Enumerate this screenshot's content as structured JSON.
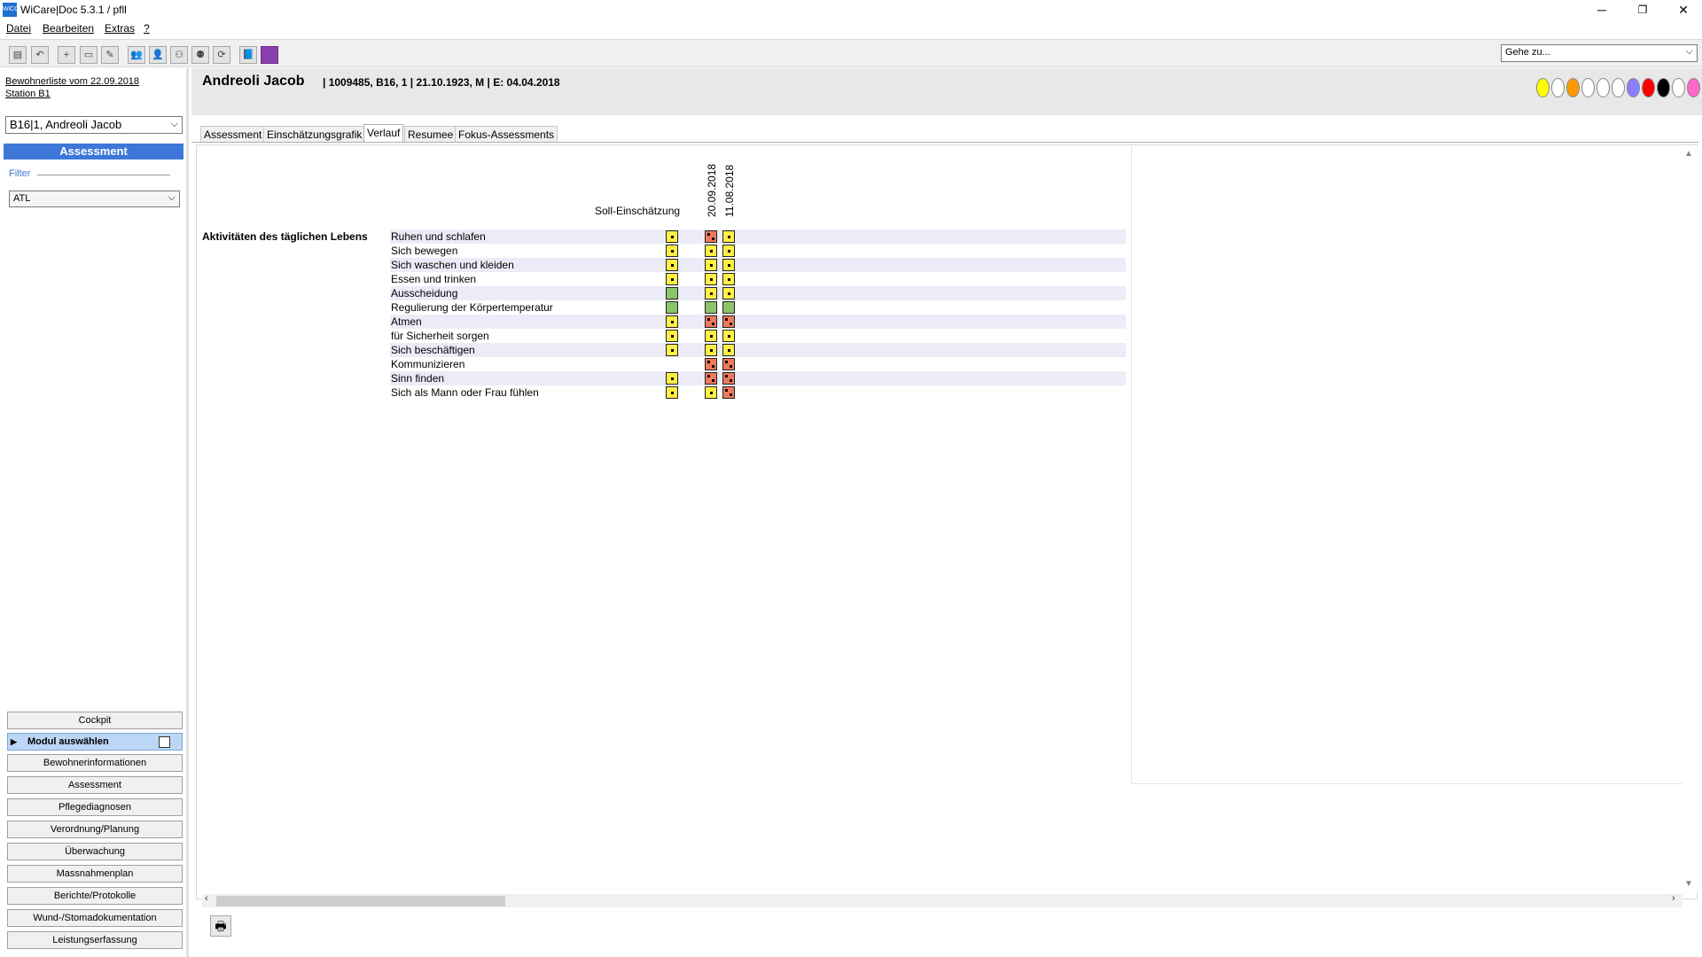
{
  "window": {
    "title": "WiCare|Doc 5.3.1  / pfll",
    "icon_text": "WiCG",
    "minimize": "─",
    "maximize": "❐",
    "close": "✕"
  },
  "menu": [
    "Datei",
    "Bearbeiten",
    "Extras",
    "?"
  ],
  "toolbar": {
    "icons": [
      "save-icon",
      "undo-icon",
      "new-icon",
      "window-icon",
      "edit-icon",
      "users-icon",
      "person-icon",
      "group-icon",
      "person-edit-icon",
      "refresh-icon",
      "book-icon",
      "purple-square-icon"
    ],
    "goto_placeholder": "Gehe zu...",
    "chevron": "⌵"
  },
  "sidebar": {
    "resident_list_link": "Bewohnerliste vom 22.09.2018",
    "station_link": "Station B1",
    "resident_select": "B16|1, Andreoli Jacob",
    "module_header": "Assessment",
    "filter_label": "Filter",
    "filter_value": "ATL",
    "nav": {
      "cockpit": "Cockpit",
      "modul": "Modul auswählen",
      "items": [
        "Bewohnerinformationen",
        "Assessment",
        "Pflegediagnosen",
        "Verordnung/Planung",
        "Überwachung",
        "Massnahmenplan",
        "Berichte/Protokolle",
        "Wund-/Stomadokumentation",
        "Leistungserfassung"
      ]
    }
  },
  "patient": {
    "name": "Andreoli Jacob",
    "info": "| 1009485, B16, 1 | 21.10.1923, M | E: 04.04.2018",
    "status_colors": [
      "#ffff00",
      "#ffffff",
      "#ff9900",
      "#ffffff",
      "#ffffff",
      "#ffffff",
      "#8a7dff",
      "#ff0000",
      "#000000",
      "#ffffff",
      "#ff66cc"
    ]
  },
  "tabs": [
    "Assessment",
    "Einschätzungsgrafik",
    "Verlauf",
    "Resumee",
    "Fokus-Assessments"
  ],
  "active_tab": "Verlauf",
  "grid": {
    "soll_header": "Soll-Einschätzung",
    "dates": [
      "20.09.2018",
      "11.08.2018"
    ],
    "category": "Aktivitäten des täglichen Lebens",
    "rows": [
      {
        "label": "Ruhen und schlafen",
        "soll": "yellow",
        "values": [
          "red",
          "yellow"
        ]
      },
      {
        "label": "Sich bewegen",
        "soll": "yellow",
        "values": [
          "yellow",
          "yellow"
        ]
      },
      {
        "label": "Sich waschen und kleiden",
        "soll": "yellow",
        "values": [
          "yellow",
          "yellow"
        ]
      },
      {
        "label": "Essen und trinken",
        "soll": "yellow",
        "values": [
          "yellow",
          "yellow"
        ]
      },
      {
        "label": "Ausscheidung",
        "soll": "green",
        "values": [
          "yellow",
          "yellow"
        ]
      },
      {
        "label": "Regulierung der Körpertemperatur",
        "soll": "green",
        "values": [
          "green",
          "green"
        ]
      },
      {
        "label": "Atmen",
        "soll": "yellow",
        "values": [
          "red",
          "red"
        ]
      },
      {
        "label": "für Sicherheit sorgen",
        "soll": "yellow",
        "values": [
          "yellow",
          "yellow"
        ]
      },
      {
        "label": "Sich beschäftigen",
        "soll": "yellow",
        "values": [
          "yellow",
          "yellow"
        ]
      },
      {
        "label": "Kommunizieren",
        "soll": "none",
        "values": [
          "red",
          "red"
        ]
      },
      {
        "label": "Sinn finden",
        "soll": "yellow",
        "values": [
          "red",
          "red"
        ]
      },
      {
        "label": "Sich als Mann oder Frau fühlen",
        "soll": "yellow",
        "values": [
          "yellow",
          "red"
        ]
      }
    ]
  },
  "print_icon": "🖶"
}
